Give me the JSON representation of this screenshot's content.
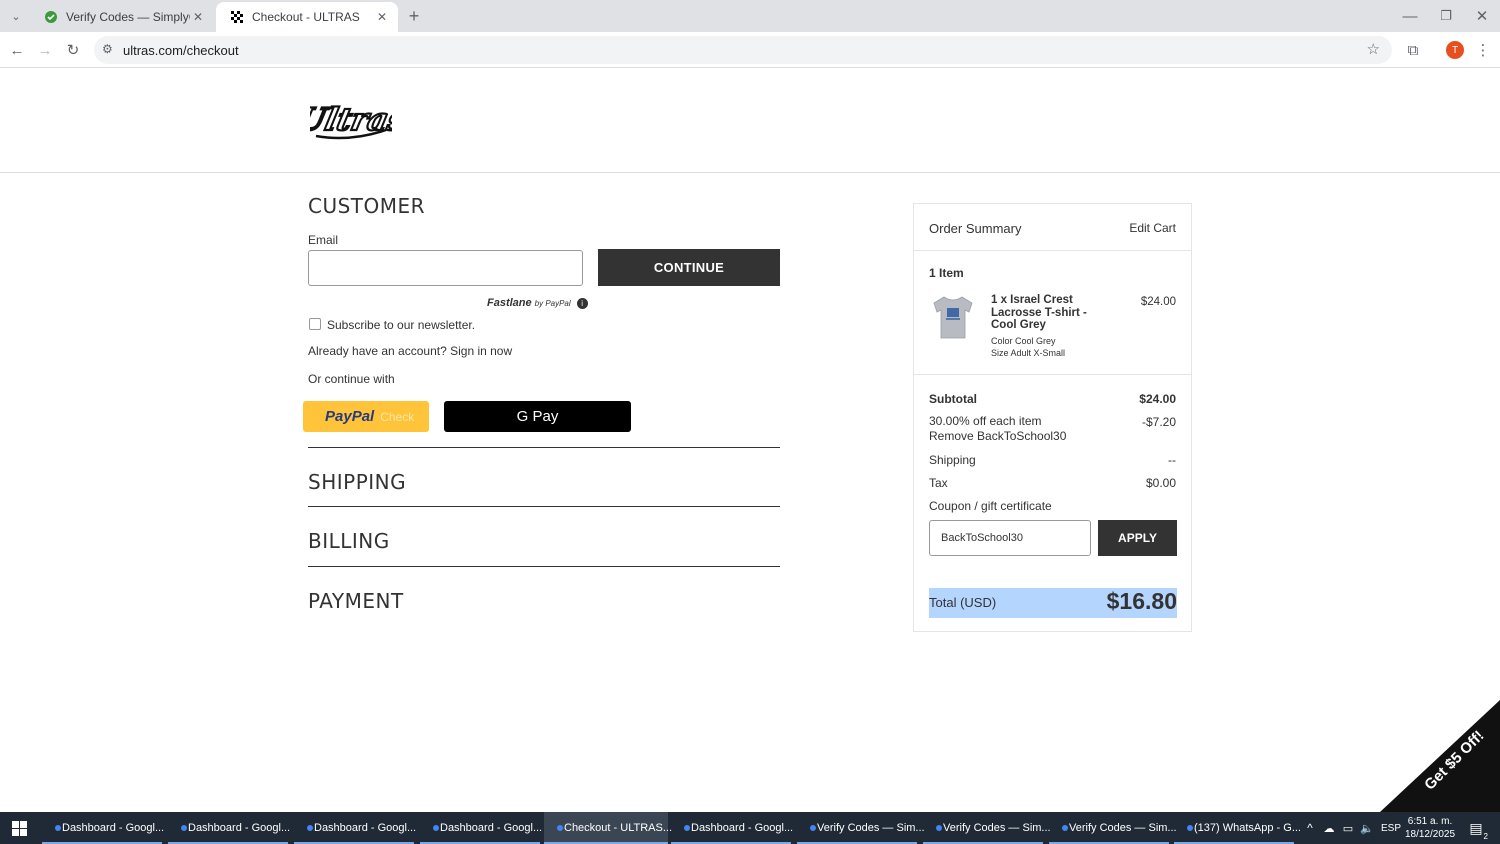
{
  "browser": {
    "tabs": [
      {
        "title": "Verify Codes — SimplyCodes",
        "active": false
      },
      {
        "title": "Checkout - ULTRAS",
        "active": true
      }
    ],
    "url": "ultras.com/checkout",
    "profile_initial": "T"
  },
  "brand": {
    "logo_text": "Ultras"
  },
  "customer": {
    "heading": "CUSTOMER",
    "email_label": "Email",
    "email_value": "",
    "continue_label": "CONTINUE",
    "fastlane_text": "Fastlane",
    "fastlane_by": "by PayPal",
    "newsletter_label": "Subscribe to our newsletter.",
    "newsletter_checked": false,
    "signin_text": "Already have an account? Sign in now",
    "or_continue": "Or continue with",
    "paypal_label": "PayPal",
    "paypal_suffix": "Check",
    "gpay_label": "G Pay"
  },
  "sections": {
    "shipping": "SHIPPING",
    "billing": "BILLING",
    "payment": "PAYMENT"
  },
  "summary": {
    "title": "Order Summary",
    "edit_cart": "Edit Cart",
    "item_count": "1 Item",
    "item": {
      "name": "1 x Israel Crest Lacrosse T-shirt - Cool Grey",
      "price": "$24.00",
      "color": "Color Cool Grey",
      "size": "Size Adult X-Small"
    },
    "subtotal_label": "Subtotal",
    "subtotal_value": "$24.00",
    "discount_label": "30.00% off each item Remove BackToSchool30",
    "discount_value": "-$7.20",
    "shipping_label": "Shipping",
    "shipping_value": "--",
    "tax_label": "Tax",
    "tax_value": "$0.00",
    "coupon_label": "Coupon / gift certificate",
    "coupon_value": "BackToSchool30",
    "apply_label": "APPLY",
    "total_label": "Total (USD)",
    "total_value": "$16.80"
  },
  "promo": {
    "text": "Get $5 Off!"
  },
  "taskbar": {
    "items": [
      {
        "label": "Dashboard - Googl...",
        "active": false
      },
      {
        "label": "Dashboard - Googl...",
        "active": false
      },
      {
        "label": "Dashboard - Googl...",
        "active": false
      },
      {
        "label": "Dashboard - Googl...",
        "active": false
      },
      {
        "label": "Checkout - ULTRAS...",
        "active": true
      },
      {
        "label": "Dashboard - Googl...",
        "active": false
      },
      {
        "label": "Verify Codes — Sim...",
        "active": false
      },
      {
        "label": "Verify Codes — Sim...",
        "active": false
      },
      {
        "label": "Verify Codes — Sim...",
        "active": false
      },
      {
        "label": "(137) WhatsApp - G...",
        "active": false
      }
    ],
    "lang": "ESP",
    "time": "6:51 a. m.",
    "date": "18/12/2025",
    "notif_count": "2"
  }
}
